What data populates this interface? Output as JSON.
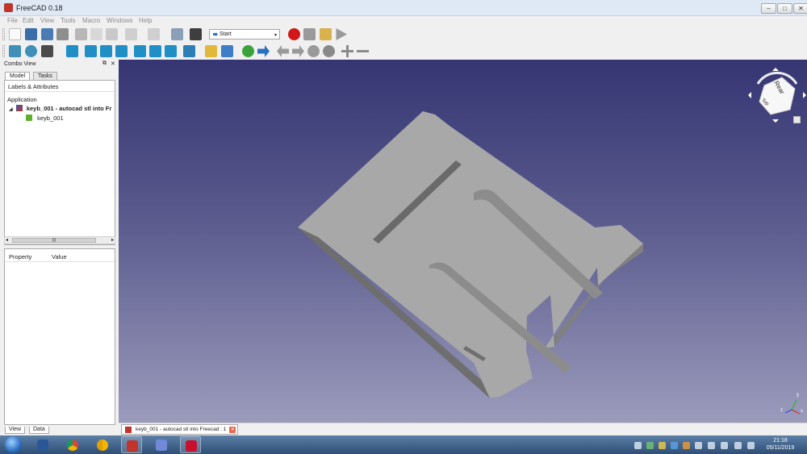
{
  "window": {
    "title": "FreeCAD 0.18",
    "min": "–",
    "max": "□",
    "close": "✕"
  },
  "menu": [
    "File",
    "Edit",
    "View",
    "Tools",
    "Macro",
    "Windows",
    "Help"
  ],
  "toolbar": {
    "workbench": "Start"
  },
  "combo": {
    "title": "Combo View",
    "tabs": [
      "Model",
      "Tasks"
    ],
    "tree_header": "Labels & Attributes",
    "application": "Application",
    "document": "keyb_001 - autocad stl into Fr",
    "object": "keyb_001",
    "prop_headers": [
      "Property",
      "Value"
    ],
    "bottom_tabs": [
      "View",
      "Data"
    ]
  },
  "document_tab": "keyb_001 - autocad stl into Freecad : 1",
  "navcube": {
    "face": "Rear",
    "edge": "Top"
  },
  "axis": {
    "x": "x",
    "y": "y",
    "z": "z"
  },
  "clock": {
    "time": "21:18",
    "date": "05/11/2019"
  },
  "colors": {
    "accent": "#2a6fc2",
    "model": "#a8a8a8",
    "record": "#d0181a"
  }
}
